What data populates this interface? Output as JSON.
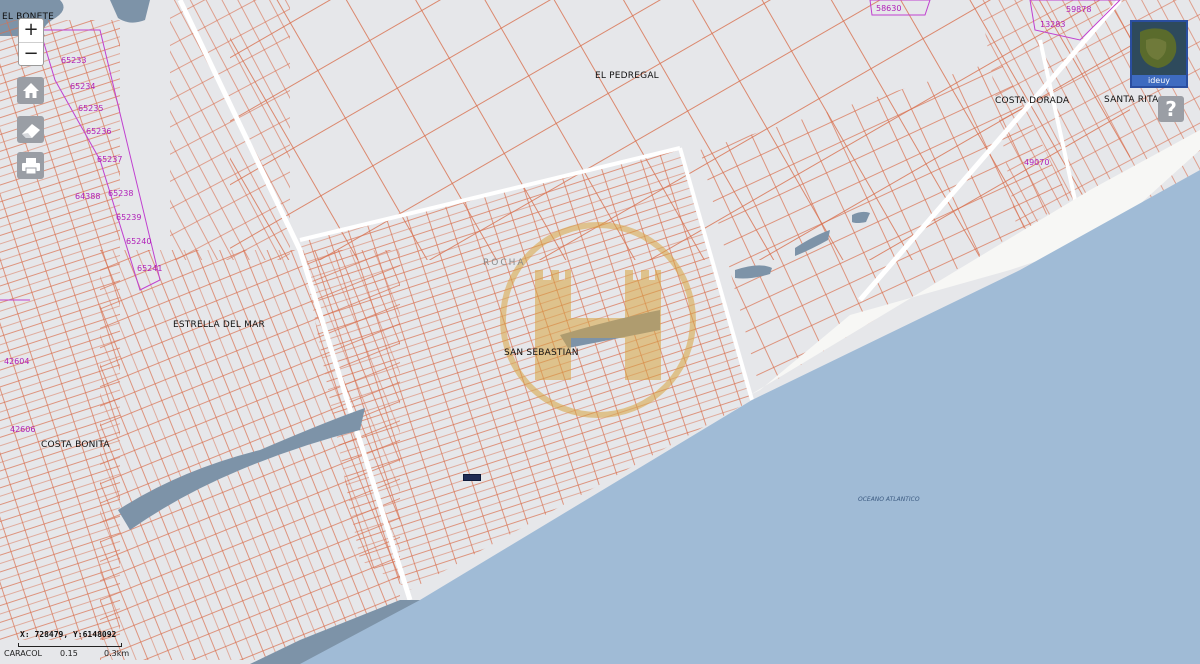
{
  "places": {
    "el_bonete": "EL BONETE",
    "el_pedregal": "EL PEDREGAL",
    "costa_dorada": "COSTA DORADA",
    "santa_rita": "SANTA RITA",
    "estrella_del_mar": "ESTRELLA DEL MAR",
    "san_sebastian": "SAN SEBASTIAN",
    "costa_bonita": "COSTA BONITA",
    "rocha": "ROCHA",
    "oceano": "OCEANO ATLANTICO"
  },
  "parcel_ids": [
    "65233",
    "65234",
    "65235",
    "65236",
    "65237",
    "64388",
    "65238",
    "65239",
    "65240",
    "65241",
    "42604",
    "42606",
    "58630",
    "13283",
    "59878",
    "49070"
  ],
  "controls": {
    "zoom_in": "+",
    "zoom_out": "−",
    "home_icon": "home-icon",
    "eraser_icon": "eraser-icon",
    "print_icon": "print-icon",
    "help": "?",
    "overview_label": "ideuy"
  },
  "status": {
    "coordinates": "X: 728479, Y:6148092",
    "scale_start_label": "CARACOL",
    "scale_mid": "0.15",
    "scale_end": "0.3km"
  },
  "colors": {
    "land": "#e6e7ea",
    "parcel_line": "#d9704f",
    "ocean": "#a0bbd6",
    "lagoon": "#7d93a8",
    "cadastral_line": "#c040d0",
    "watermark": "#d9a441"
  }
}
